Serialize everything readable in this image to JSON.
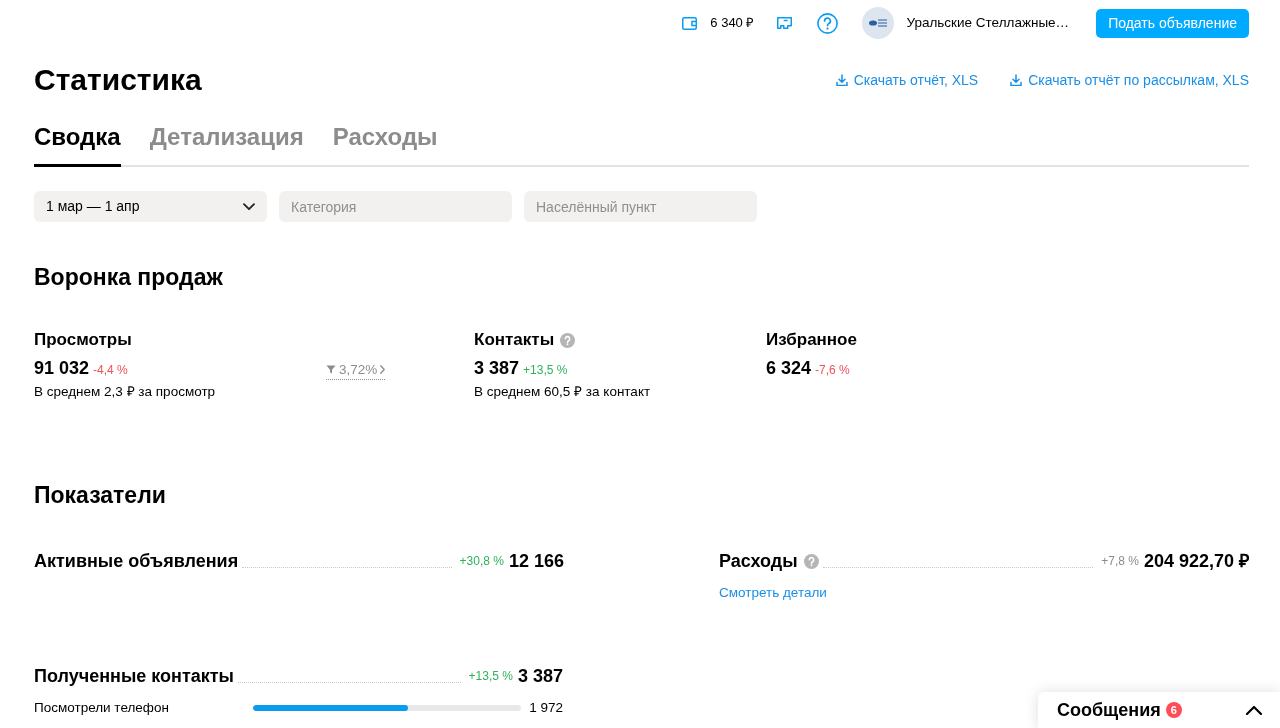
{
  "header": {
    "balance": "6 340 ₽",
    "company": "Уральские Стеллажные…",
    "post_button": "Подать объявление"
  },
  "page": {
    "title": "Статистика",
    "downloads": [
      "Скачать отчёт, XLS",
      "Скачать отчёт по рассылкам, XLS"
    ]
  },
  "tabs": [
    {
      "label": "Сводка",
      "selected": true
    },
    {
      "label": "Детализация",
      "selected": false
    },
    {
      "label": "Расходы",
      "selected": false
    }
  ],
  "filters": [
    {
      "kind": "select",
      "value": "1 мар — 1 апр"
    },
    {
      "kind": "input",
      "placeholder": "Категория"
    },
    {
      "kind": "input",
      "placeholder": "Населённый пункт"
    }
  ],
  "funnel": {
    "title": "Воронка продаж",
    "items": [
      {
        "kind": "metric",
        "label": "Просмотры",
        "value": "91 032",
        "change": "-4,4 %",
        "color": "#f0505a",
        "note": "В среднем 2,3 ₽ за просмотр"
      },
      {
        "kind": "conversion",
        "value": "3,72%"
      },
      {
        "kind": "metric",
        "label": "Контакты",
        "help": true,
        "value": "3 387",
        "change": "+13,5 %",
        "color": "#2db25c",
        "note": "В среднем 60,5 ₽ за контакт"
      },
      {
        "kind": "metric",
        "label": "Избранное",
        "value": "6 324",
        "change": "-7,6 %",
        "color": "#f0505a"
      }
    ]
  },
  "indicators": {
    "title": "Показатели",
    "items": [
      {
        "label": "Активные объявления",
        "change": "+30,8 %",
        "color": "#2db25c",
        "value": "12 166"
      },
      {
        "label": "Расходы",
        "help": true,
        "change": "+7,8 %",
        "color": "#8c8c8c",
        "value": "204 922,70 ₽",
        "link": "Смотреть детали"
      }
    ]
  },
  "contacts": {
    "label": "Полученные контакты",
    "change": "+13,5 %",
    "color": "#2db25c",
    "value": "3 387",
    "rows": [
      {
        "label": "Посмотрели телефон",
        "level": 0.58,
        "value": "1 972"
      }
    ]
  },
  "messages": {
    "label": "Сообщения",
    "count": "6",
    "expanded": false
  }
}
